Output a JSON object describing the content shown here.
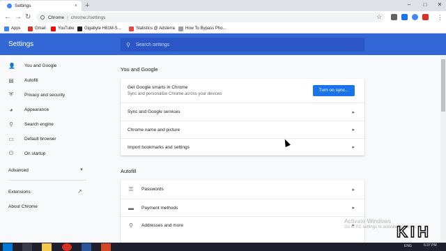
{
  "browser": {
    "tab_title": "Settings",
    "tab_close": "×",
    "new_tab": "+",
    "window_controls": {
      "minimize": "–",
      "maximize": "□",
      "close": "✕"
    },
    "omnibox": {
      "scheme": "Chrome",
      "separator": "|",
      "url": "chrome://settings"
    },
    "nav": {
      "back": "←",
      "forward": "→",
      "reload": "↻"
    },
    "star": "☆",
    "menu": "⋮",
    "extension_colors": [
      "#5f6368",
      "#1a73e8",
      "#4285f4",
      "#d93025"
    ]
  },
  "bookmarks": [
    {
      "label": "Apps",
      "icon": "apps-grid-icon",
      "color": "#4285f4"
    },
    {
      "label": "Gmail",
      "icon": "gmail-icon",
      "color": "#d93025"
    },
    {
      "label": "YouTube",
      "icon": "youtube-icon",
      "color": "#ff0000"
    },
    {
      "label": "Gigabyte H81M-S...",
      "icon": "gigabyte-icon",
      "color": "#1a1a1a"
    },
    {
      "label": "Statistics @ Adsterra",
      "icon": "adsterra-icon",
      "color": "#e8453c"
    },
    {
      "label": "How To Bypass Pho...",
      "icon": "page-icon",
      "color": "#9aa0a6"
    }
  ],
  "header": {
    "title": "Settings",
    "search_placeholder": "Search settings"
  },
  "sidebar": {
    "items": [
      {
        "label": "You and Google",
        "icon": "person-icon",
        "glyph": "👤"
      },
      {
        "label": "Autofill",
        "icon": "clipboard-icon",
        "glyph": "▤"
      },
      {
        "label": "Privacy and security",
        "icon": "shield-icon",
        "glyph": "⛨"
      },
      {
        "label": "Appearance",
        "icon": "palette-icon",
        "glyph": "◕"
      },
      {
        "label": "Search engine",
        "icon": "search-icon",
        "glyph": "⚲"
      },
      {
        "label": "Default browser",
        "icon": "browser-icon",
        "glyph": "▭"
      },
      {
        "label": "On startup",
        "icon": "power-icon",
        "glyph": "⏻"
      }
    ],
    "advanced": "Advanced",
    "advanced_chevron": "▼",
    "extensions": "Extensions",
    "extensions_icon": "↗",
    "about": "About Chrome"
  },
  "main": {
    "you_and_google": {
      "title": "You and Google",
      "sync_title": "Get Google smarts in Chrome",
      "sync_subtitle": "Sync and personalize Chrome across your devices",
      "sync_button": "Turn on sync...",
      "rows": [
        "Sync and Google services",
        "Chrome name and picture",
        "Import bookmarks and settings"
      ]
    },
    "autofill": {
      "title": "Autofill",
      "rows": [
        {
          "label": "Passwords",
          "icon": "key-icon",
          "glyph": "⚿"
        },
        {
          "label": "Payment methods",
          "icon": "credit-card-icon",
          "glyph": "▬"
        },
        {
          "label": "Addresses and more",
          "icon": "location-pin-icon",
          "glyph": "⚲"
        }
      ]
    },
    "row_arrow": "▸"
  },
  "watermark": {
    "line1": "Activate Windows",
    "line2": "Go to PC settings to activate Windows.",
    "logo": "KIH"
  },
  "taskbar": {
    "tray": "ENG",
    "clock": "6:37 PM",
    "app_colors": [
      "#0078d7",
      "#ffffff",
      "#f2c94c",
      "#d93025",
      "#2b579a",
      "#d24726"
    ]
  }
}
